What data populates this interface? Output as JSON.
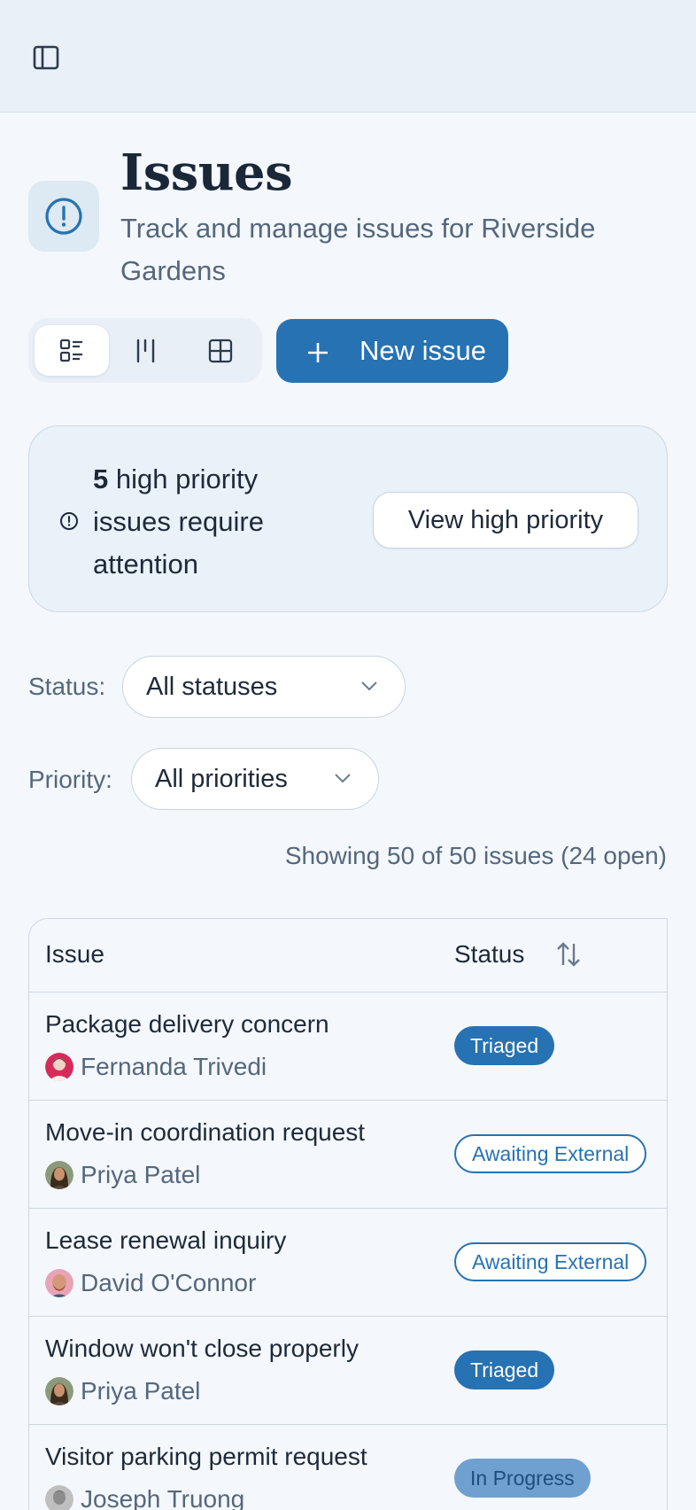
{
  "topbar": {
    "sidebar_toggle_icon": "sidebar-panel-icon"
  },
  "header": {
    "icon": "alert-circle-icon",
    "title": "Issues",
    "subtitle": "Track and manage issues for Riverside Gardens"
  },
  "toolbar": {
    "views": [
      {
        "name": "list-view",
        "icon": "list-icon",
        "active": true
      },
      {
        "name": "board-view",
        "icon": "kanban-icon",
        "active": false
      },
      {
        "name": "grid-view",
        "icon": "grid-icon",
        "active": false
      }
    ],
    "new_issue_label": "New issue"
  },
  "alert": {
    "count": "5",
    "text_after_count": " high priority issues require attention",
    "button_label": "View high priority"
  },
  "filters": {
    "status_label": "Status:",
    "status_value": "All statuses",
    "priority_label": "Priority:",
    "priority_value": "All priorities"
  },
  "summary": "Showing 50 of 50 issues (24 open)",
  "table": {
    "columns": [
      "Issue",
      "Status"
    ],
    "rows": [
      {
        "title": "Package delivery concern",
        "person": "Fernanda Trivedi",
        "status": "Triaged",
        "style": "filled"
      },
      {
        "title": "Move-in coordination request",
        "person": "Priya Patel",
        "status": "Awaiting External",
        "style": "outline"
      },
      {
        "title": "Lease renewal inquiry",
        "person": "David O'Connor",
        "status": "Awaiting External",
        "style": "outline"
      },
      {
        "title": "Window won't close properly",
        "person": "Priya Patel",
        "status": "Triaged",
        "style": "filled"
      },
      {
        "title": "Visitor parking permit request",
        "person": "Joseph Truong",
        "status": "In Progress",
        "style": "progress"
      }
    ]
  },
  "colors": {
    "accent": "#2672b3",
    "background": "#f4f8fc",
    "topbar": "#e9f0f8",
    "muted_text": "#55677c"
  }
}
